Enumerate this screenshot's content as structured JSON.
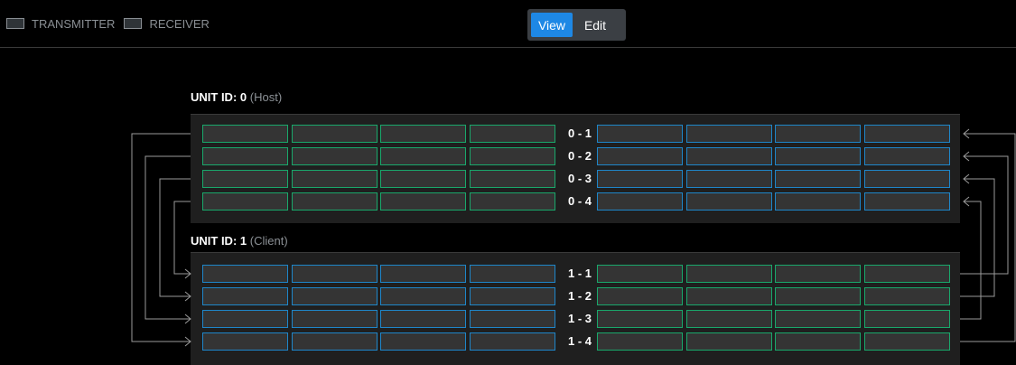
{
  "legend": [
    {
      "label": "TRANSMITTER",
      "kind": "transmitter",
      "color": "#19a86b"
    },
    {
      "label": "RECEIVER",
      "kind": "receiver",
      "color": "#1e86c9"
    }
  ],
  "mode_toggle": {
    "view_label": "View",
    "edit_label": "Edit",
    "selected": "View"
  },
  "units": [
    {
      "id_label": "UNIT ID:",
      "id": "0",
      "role": "(Host)",
      "left_type": "transmitter",
      "right_type": "receiver",
      "channels": [
        "0 - 1",
        "0 - 2",
        "0 - 3",
        "0 - 4"
      ]
    },
    {
      "id_label": "UNIT ID:",
      "id": "1",
      "role": "(Client)",
      "left_type": "receiver",
      "right_type": "transmitter",
      "channels": [
        "1 - 1",
        "1 - 2",
        "1 - 3",
        "1 - 4"
      ]
    }
  ],
  "colors": {
    "transmitter": "#19a86b",
    "receiver": "#1e86c9",
    "wire": "#9a9a9a",
    "toggle_active": "#1e88e5"
  }
}
